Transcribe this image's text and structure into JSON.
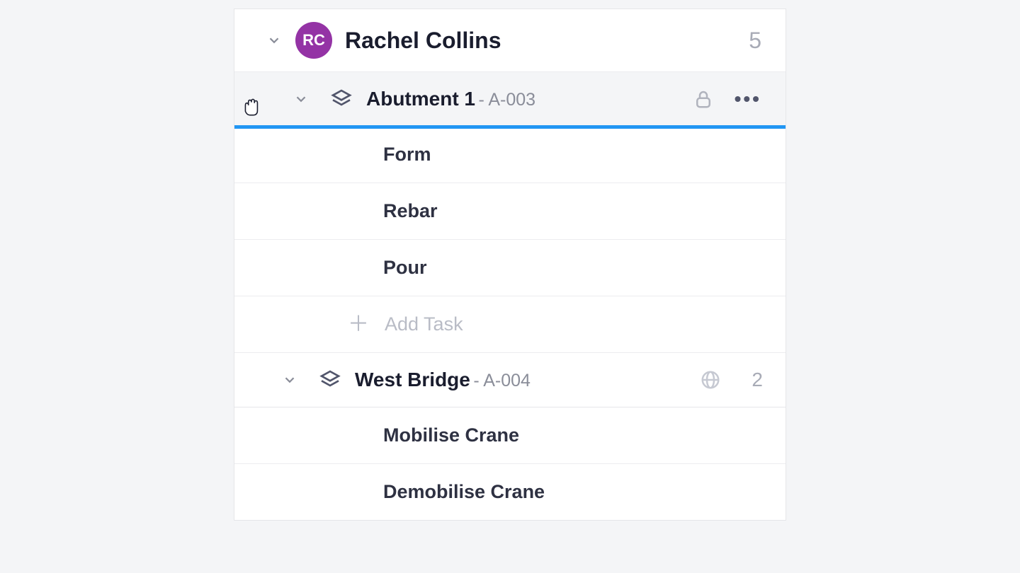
{
  "assignee": {
    "initials": "RC",
    "name": "Rachel Collins",
    "count": "5"
  },
  "groups": [
    {
      "title": "Abutment 1",
      "code": "- A-003",
      "selected": true,
      "tasks": [
        "Form",
        "Rebar",
        "Pour"
      ],
      "addLabel": "Add Task"
    },
    {
      "title": "West Bridge",
      "code": "- A-004",
      "selected": false,
      "count": "2",
      "tasks": [
        "Mobilise Crane",
        "Demobilise Crane"
      ]
    }
  ]
}
